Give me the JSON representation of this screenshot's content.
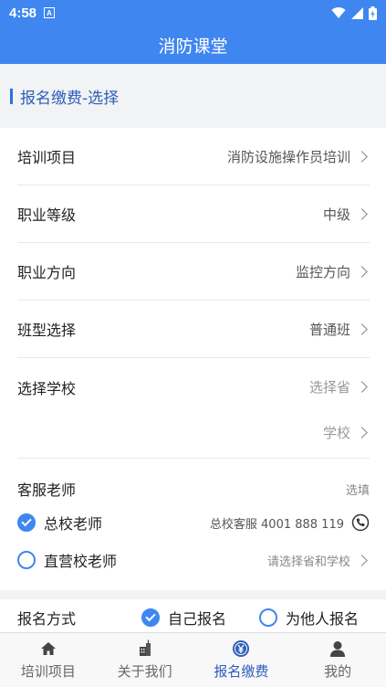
{
  "status_bar": {
    "time": "4:58",
    "notification_letter": "A"
  },
  "app": {
    "title": "消防课堂"
  },
  "section": {
    "title": "报名缴费-选择"
  },
  "form_rows": [
    {
      "label": "培训项目",
      "value": "消防设施操作员培训",
      "placeholder": false
    },
    {
      "label": "职业等级",
      "value": "中级",
      "placeholder": false
    },
    {
      "label": "职业方向",
      "value": "监控方向",
      "placeholder": false
    },
    {
      "label": "班型选择",
      "value": "普通班",
      "placeholder": false
    },
    {
      "label": "选择学校",
      "value": "选择省",
      "placeholder": true
    },
    {
      "label": "",
      "value": "学校",
      "placeholder": true
    }
  ],
  "service": {
    "title": "客服老师",
    "optional": "选填",
    "options": [
      {
        "label": "总校老师",
        "checked": true,
        "right_text": "总校客服 4001 888 119",
        "icon": "phone-icon"
      },
      {
        "label": "直营校老师",
        "checked": false,
        "right_text": "请选择省和学校",
        "icon": "chevron-right-icon"
      }
    ]
  },
  "signup_method": {
    "label": "报名方式",
    "options": [
      {
        "label": "自己报名",
        "checked": true
      },
      {
        "label": "为他人报名",
        "checked": false
      }
    ]
  },
  "tabs": [
    {
      "label": "培训项目",
      "icon": "home-icon",
      "active": false
    },
    {
      "label": "关于我们",
      "icon": "building-icon",
      "active": false
    },
    {
      "label": "报名缴费",
      "icon": "yen-payment-icon",
      "active": true
    },
    {
      "label": "我的",
      "icon": "user-icon",
      "active": false
    }
  ],
  "colors": {
    "primary": "#3f86f0",
    "active_tab": "#2f5db8"
  }
}
